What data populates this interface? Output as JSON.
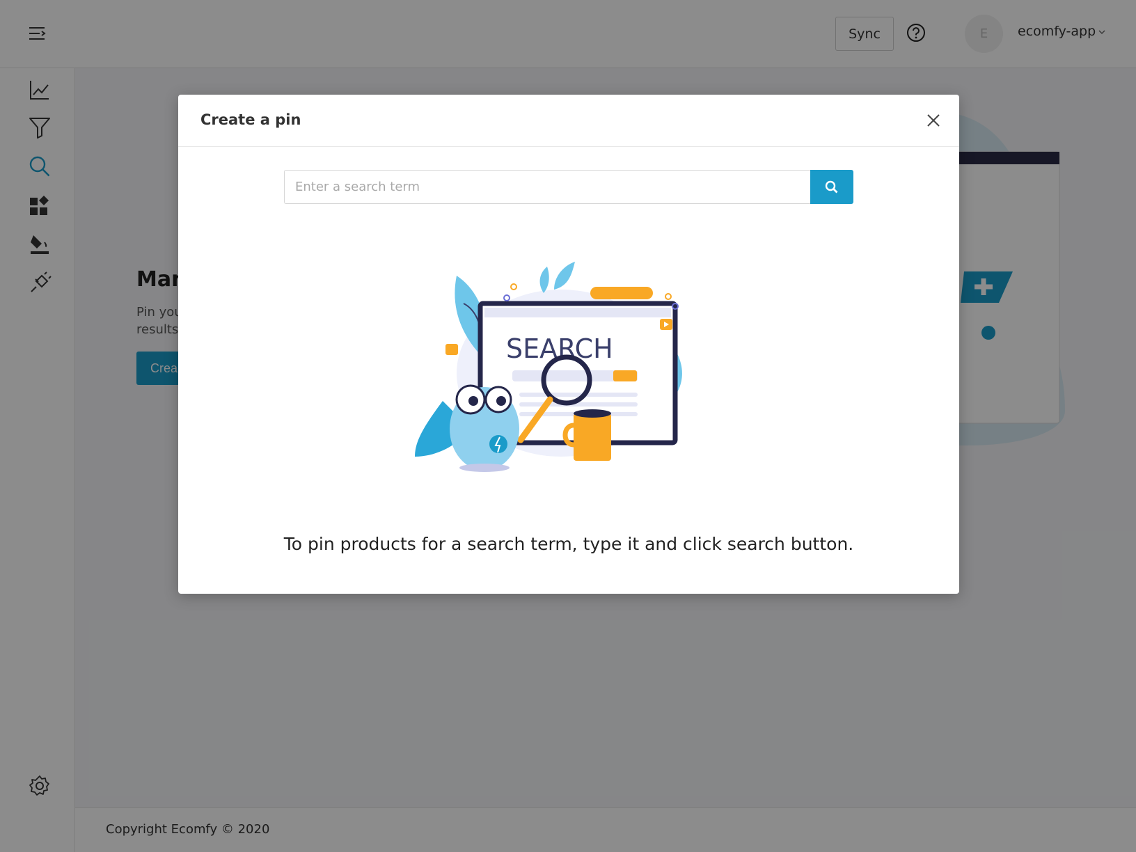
{
  "header": {
    "sync_label": "Sync",
    "avatar_initial": "E",
    "account_name": "ecomfy-app"
  },
  "sidebar": {
    "items": [
      {
        "icon": "line-chart-icon"
      },
      {
        "icon": "filter-icon"
      },
      {
        "icon": "search-icon",
        "active": true
      },
      {
        "icon": "widgets-icon"
      },
      {
        "icon": "paint-bucket-icon"
      },
      {
        "icon": "plug-icon"
      }
    ],
    "bottom_icon": "gear-icon"
  },
  "background": {
    "title": "Man",
    "desc_line1": "Pin you",
    "desc_line2": "results.",
    "create_label": "Crea"
  },
  "footer": {
    "text": "Copyright Ecomfy © 2020"
  },
  "modal": {
    "title": "Create a pin",
    "search_placeholder": "Enter a search term",
    "search_value": "",
    "illustration_text": "SEARCH",
    "message": "To pin products for a search term, type it and click search button."
  },
  "colors": {
    "accent": "#1a9bc9",
    "overlay": "rgba(0,0,0,0.45)",
    "navy": "#3a3f6b",
    "orange": "#f9a825",
    "sky": "#6ec6ea"
  }
}
